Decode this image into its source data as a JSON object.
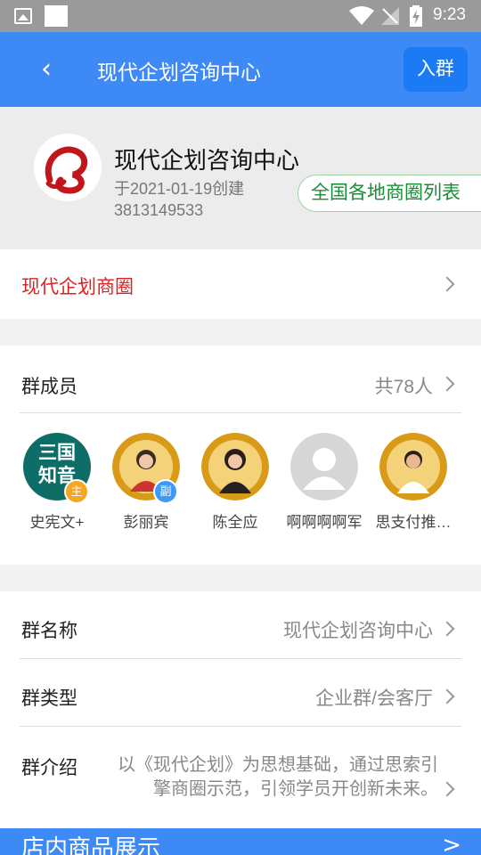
{
  "status_bar": {
    "time": "9:23"
  },
  "header": {
    "back_icon": "‹",
    "title": "现代企划咨询中心",
    "join_label": "入群"
  },
  "profile": {
    "name": "现代企划咨询中心",
    "created": "于2021-01-19创建",
    "group_id": "3813149533",
    "list_button": "全国各地商圈列表"
  },
  "circle": {
    "label": "现代企划商圈",
    "label_color": "#e02020"
  },
  "members": {
    "label": "群成员",
    "count": "共78人",
    "items": [
      {
        "name": "史宪文+",
        "tag": "主",
        "tag_color": "#f5a623",
        "avatar_text": "三国 知音"
      },
      {
        "name": "彭丽宾",
        "tag": "副",
        "tag_color": "#3d9af7",
        "avatar_text": ""
      },
      {
        "name": "陈全应",
        "tag": "",
        "tag_color": "",
        "avatar_text": ""
      },
      {
        "name": "啊啊啊啊军",
        "tag": "",
        "tag_color": "",
        "avatar_text": ""
      },
      {
        "name": "思支付推…",
        "tag": "",
        "tag_color": "",
        "avatar_text": ""
      }
    ]
  },
  "info": {
    "group_name_label": "群名称",
    "group_name_value": "现代企划咨询中心",
    "group_type_label": "群类型",
    "group_type_value": "企业群/会客厅",
    "intro_label": "群介绍",
    "intro_value": "以《现代企划》为思想基础，通过思索引擎商圈示范，引领学员开创新未来。"
  },
  "shop": {
    "label": "店内商品展示",
    "arrow": ">"
  },
  "colors": {
    "header_blue": "#3d8af7",
    "button_blue": "#1a7bf5",
    "green": "#1b8c35"
  }
}
